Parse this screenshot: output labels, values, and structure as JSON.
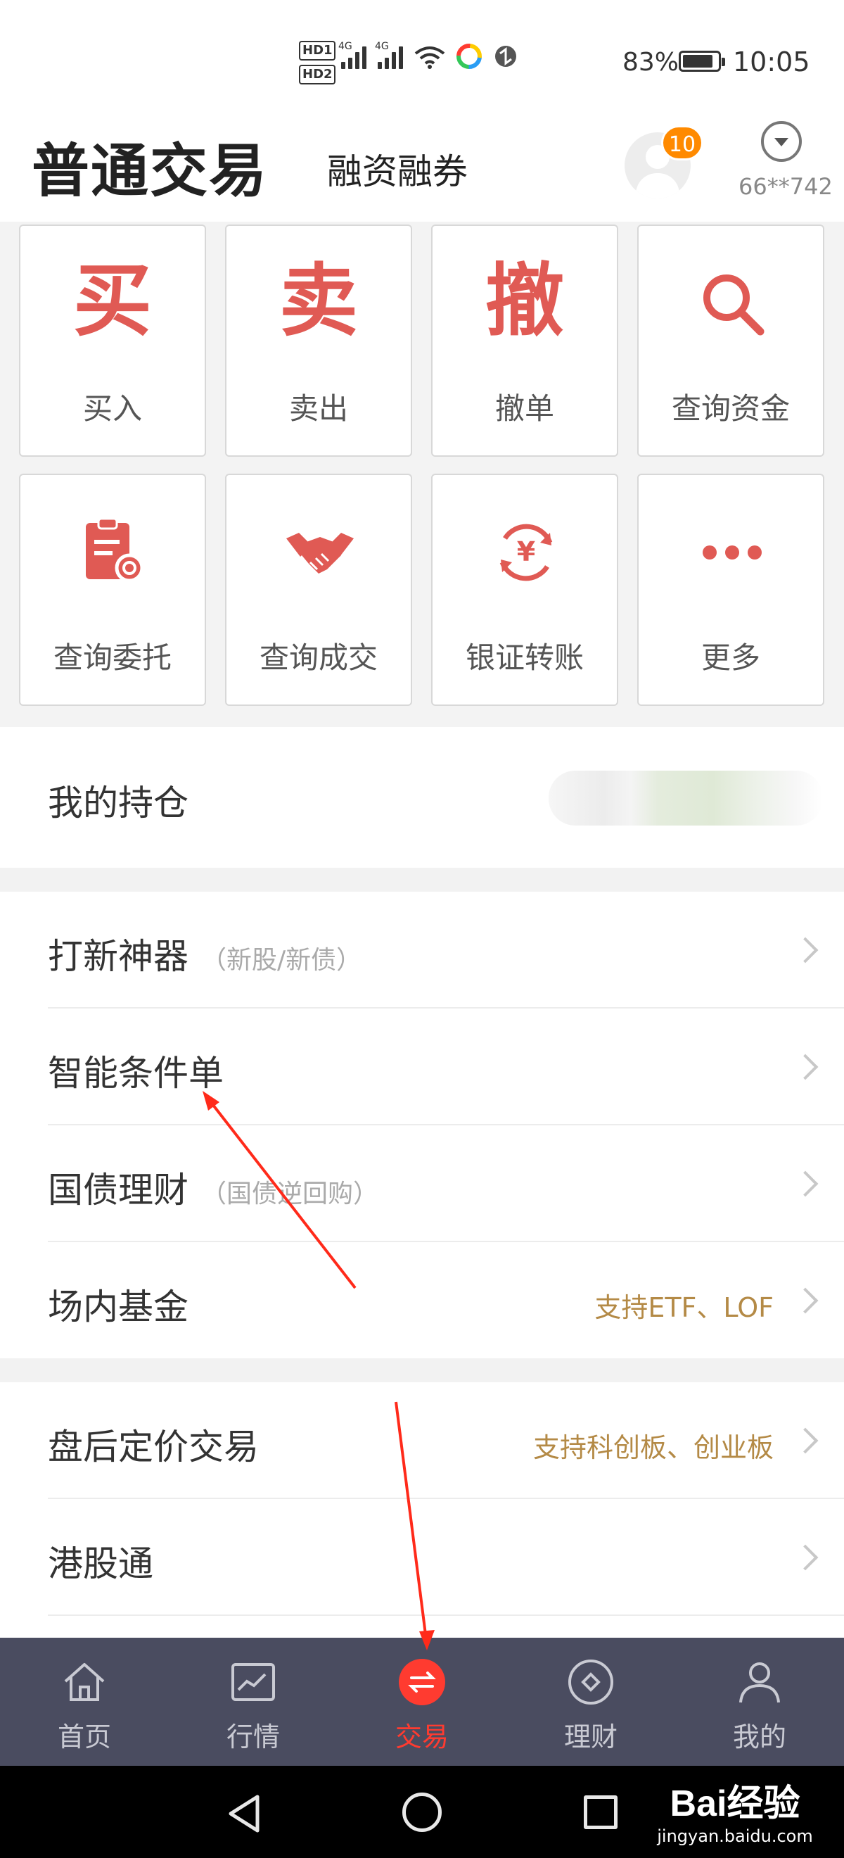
{
  "status_bar": {
    "hd1": "HD1",
    "hd2": "HD2",
    "net1": "4G",
    "net2": "4G",
    "battery_percent": "83%",
    "time": "10:05"
  },
  "header": {
    "title": "普通交易",
    "subtitle": "融资融券",
    "badge_count": "10",
    "account_id": "66**742"
  },
  "grid": [
    {
      "glyph": "买",
      "label": "买入"
    },
    {
      "glyph": "卖",
      "label": "卖出"
    },
    {
      "glyph": "撤",
      "label": "撤单"
    },
    {
      "icon": "search-icon",
      "label": "查询资金"
    },
    {
      "icon": "document-search-icon",
      "label": "查询委托"
    },
    {
      "icon": "handshake-icon",
      "label": "查询成交"
    },
    {
      "icon": "yuan-transfer-icon",
      "label": "银证转账"
    },
    {
      "icon": "more-dots-icon",
      "label": "更多"
    }
  ],
  "holdings": {
    "title": "我的持仓"
  },
  "list1": [
    {
      "name": "打新神器",
      "note": "（新股/新债）",
      "right": ""
    },
    {
      "name": "智能条件单",
      "note": "",
      "right": ""
    },
    {
      "name": "国债理财",
      "note": "（国债逆回购）",
      "right": ""
    },
    {
      "name": "场内基金",
      "note": "",
      "right": "支持ETF、LOF"
    }
  ],
  "list2": [
    {
      "name": "盘后定价交易",
      "note": "",
      "right": "支持科创板、创业板"
    },
    {
      "name": "港股通",
      "note": "",
      "right": ""
    }
  ],
  "nav": [
    {
      "label": "首页",
      "icon": "home-icon"
    },
    {
      "label": "行情",
      "icon": "chart-icon"
    },
    {
      "label": "交易",
      "icon": "exchange-icon",
      "active": true
    },
    {
      "label": "理财",
      "icon": "diamond-icon"
    },
    {
      "label": "我的",
      "icon": "user-icon"
    }
  ],
  "watermark": {
    "brand": "Bai经验",
    "url": "jingyan.baidu.com"
  },
  "colors": {
    "accent": "#e05a54",
    "badge": "#ff8a00",
    "nav_bg": "#4a4c60",
    "active": "#ff3b30",
    "gold": "#b48a46"
  }
}
